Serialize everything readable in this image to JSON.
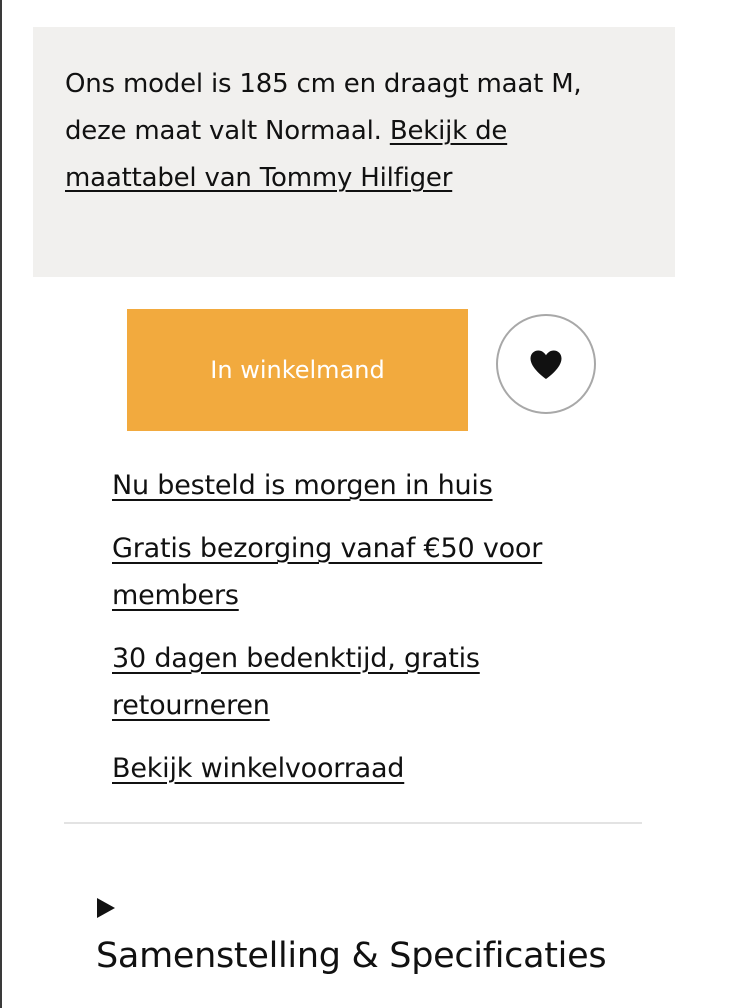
{
  "size_info": {
    "text": "Ons model is 185 cm en draagt maat M, deze maat valt Normaal.",
    "size_chart_link": "Bekijk de maattabel van Tommy Hilfiger"
  },
  "actions": {
    "add_to_cart_label": "In winkelmand",
    "wishlist_icon": "heart-icon",
    "accent_color": "#f2aa3e"
  },
  "usps": [
    {
      "label": "Nu besteld is morgen in huis"
    },
    {
      "label": "Gratis bezorging vanaf €50 voor members"
    },
    {
      "label": "30 dagen bedenktijd, gratis retourneren"
    },
    {
      "label": "Bekijk winkelvoorraad"
    }
  ],
  "details": {
    "toggle_icon": "triangle-right-icon",
    "title": "Samenstelling & Specificaties"
  }
}
